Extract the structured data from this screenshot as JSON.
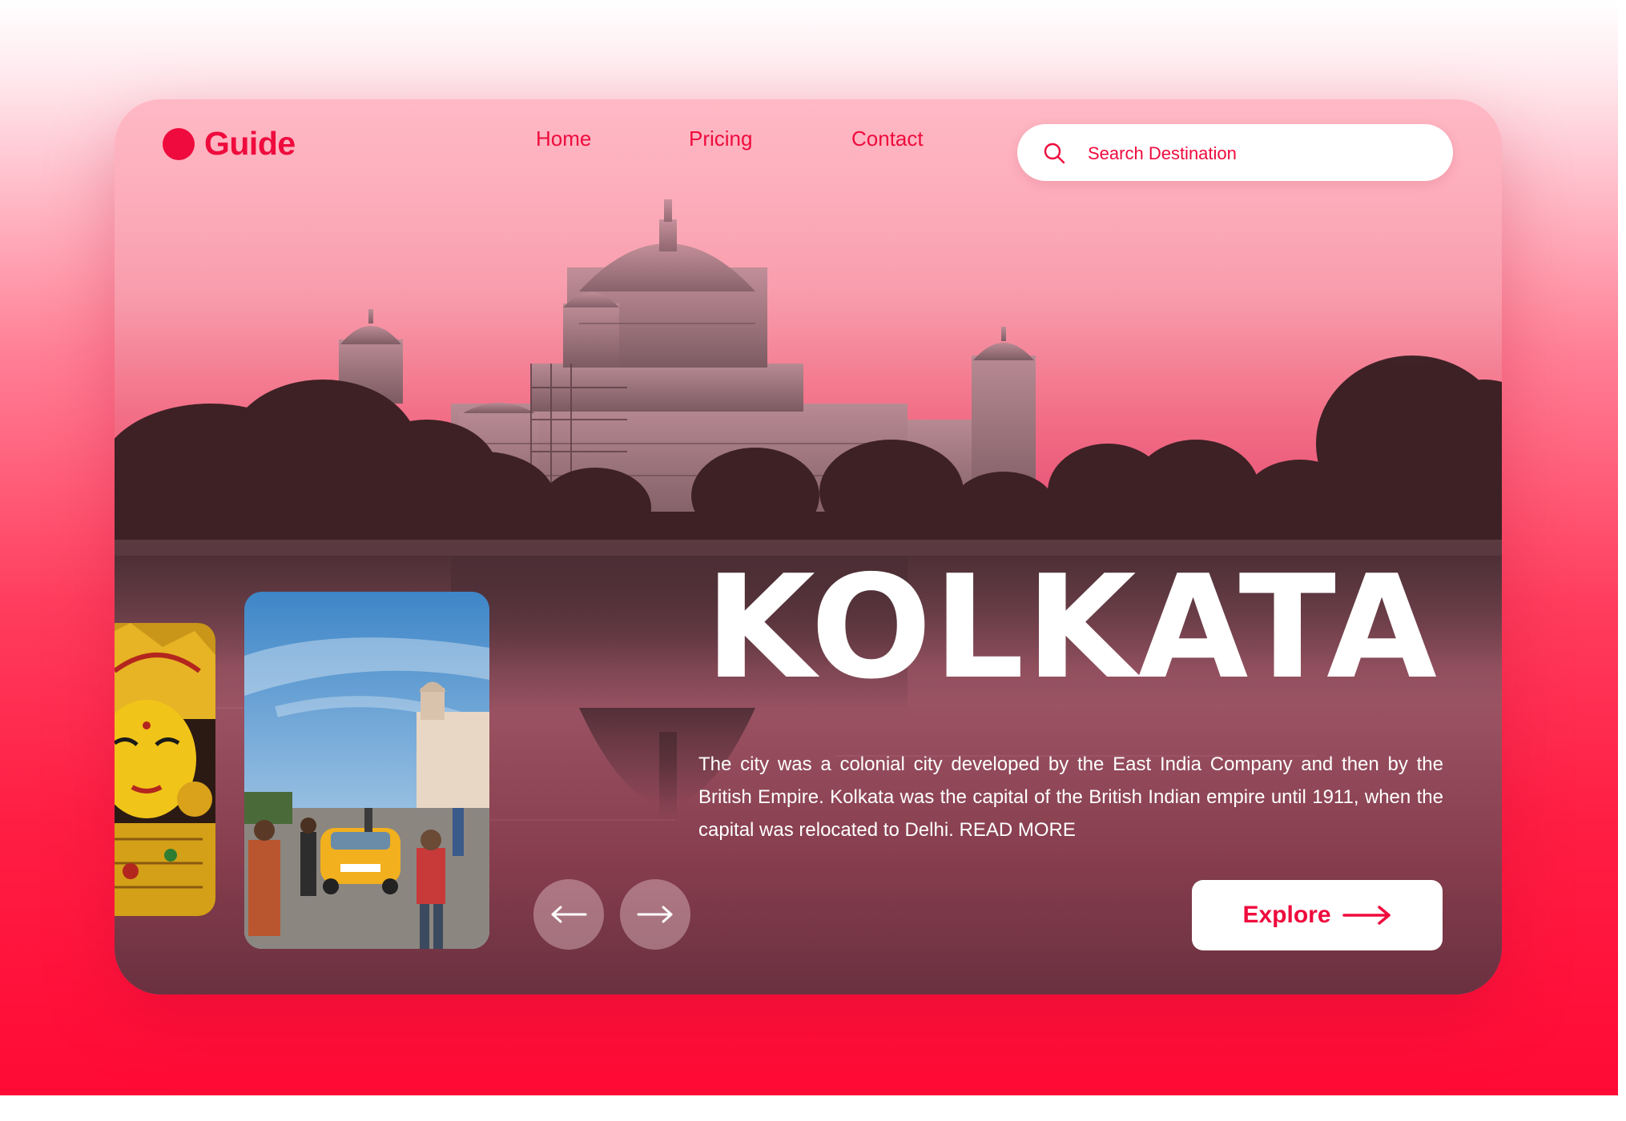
{
  "brand": {
    "name": "Guide",
    "color": "#ef0b3d"
  },
  "nav": [
    {
      "label": "Home"
    },
    {
      "label": "Pricing"
    },
    {
      "label": "Contact"
    }
  ],
  "search": {
    "placeholder": "Search Destination",
    "icon": "search-icon"
  },
  "hero": {
    "title": "KOLKATA",
    "description": "The city was a colonial city developed by the East India Company and then by the British Empire. Kolkata was the capital of the British Indian empire until 1911, when the capital was relocated to Delhi.",
    "read_more": "READ MORE",
    "background_image": "victoria-memorial-pink-sky",
    "thumbnails": [
      "durga-idol",
      "yellow-taxi-street"
    ]
  },
  "controls": {
    "prev_icon": "arrow-left-icon",
    "next_icon": "arrow-right-icon",
    "explore_label": "Explore",
    "explore_icon": "arrow-right-long-icon"
  },
  "colors": {
    "accent": "#ef0b3d",
    "white": "#ffffff",
    "button_translucent": "rgba(255,230,235,0.35)"
  }
}
